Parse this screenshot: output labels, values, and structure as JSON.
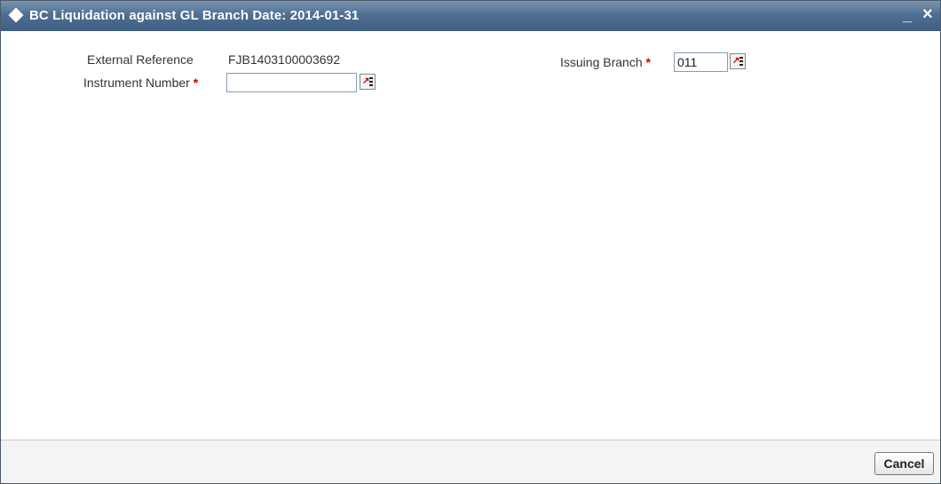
{
  "window": {
    "title": "BC Liquidation against GL  Branch Date: 2014-01-31",
    "minimize_label": "_",
    "close_label": "×"
  },
  "form": {
    "external_reference": {
      "label": "External Reference",
      "value": "FJB1403100003692"
    },
    "instrument_number": {
      "label": "Instrument Number",
      "required_marker": "*",
      "value": ""
    },
    "issuing_branch": {
      "label": "Issuing Branch",
      "required_marker": "*",
      "value": "011"
    }
  },
  "footer": {
    "cancel_label": "Cancel"
  },
  "colors": {
    "title_bar": "#4f6f92",
    "required": "#cc0000"
  }
}
